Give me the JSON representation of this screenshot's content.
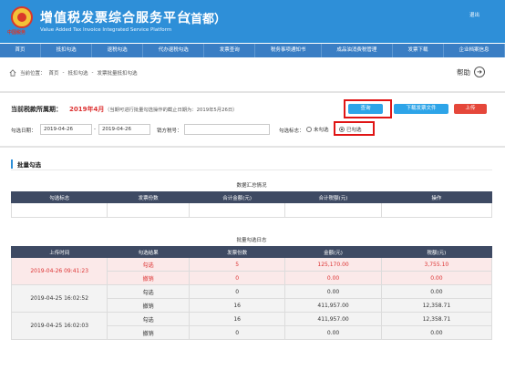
{
  "header": {
    "logo_text": "中国税务",
    "title": "增值税发票综合服务平台",
    "region": "（首都）",
    "subtitle": "Value Added Tax Invoice Integrated Service Platform",
    "logout": "退出"
  },
  "nav": {
    "items": [
      "首页",
      "抵扣勾选",
      "退税勾选",
      "代办退税勾选",
      "发票查询",
      "税务事项通知书",
      "成品油消费税管理",
      "发票下载",
      "企业档案信息"
    ]
  },
  "breadcrumb": {
    "prefix": "当前位置：",
    "path": [
      "首页",
      "抵扣勾选",
      "发票批量抵扣勾选"
    ],
    "separator": "-"
  },
  "help": {
    "label": "帮助",
    "icon": "arrow-right-circle-icon"
  },
  "period": {
    "label": "当前税款所属期：",
    "value": "2019年4月",
    "note": "（当期可进行批量勾选操作的截止日期为：2019年5月26日）"
  },
  "buttons": {
    "query": "查询",
    "download": "下载发票文件",
    "upload": "上传"
  },
  "filters": {
    "date_label": "勾选日期：",
    "date_from": "2019-04-26",
    "date_sep": "-",
    "date_to": "2019-04-26",
    "taxid_label": "销方税号：",
    "taxid_value": "",
    "flag_label": "勾选标志：",
    "options": [
      "未勾选",
      "已勾选"
    ],
    "selected": "已勾选"
  },
  "section": {
    "title": "批量勾选"
  },
  "summary": {
    "caption": "数据汇总情况",
    "columns": [
      "勾选标志",
      "发票份数",
      "合计金额(元)",
      "合计税额(元)",
      "操作"
    ],
    "rows": []
  },
  "log": {
    "caption": "批量勾选日志",
    "columns": [
      "上传时间",
      "勾选结果",
      "发票份数",
      "金额(元)",
      "税额(元)"
    ],
    "groups": [
      {
        "time": "2019-04-26 09:41:23",
        "rows": [
          {
            "result": "勾选",
            "count": "5",
            "amount": "125,170.00",
            "tax": "3,755.10"
          },
          {
            "result": "撤销",
            "count": "0",
            "amount": "0.00",
            "tax": "0.00"
          }
        ]
      },
      {
        "time": "2019-04-25 16:02:52",
        "rows": [
          {
            "result": "勾选",
            "count": "0",
            "amount": "0.00",
            "tax": "0.00"
          },
          {
            "result": "撤销",
            "count": "16",
            "amount": "411,957.00",
            "tax": "12,358.71"
          }
        ]
      },
      {
        "time": "2019-04-25 16:02:03",
        "rows": [
          {
            "result": "勾选",
            "count": "16",
            "amount": "411,957.00",
            "tax": "12,358.71"
          },
          {
            "result": "撤销",
            "count": "0",
            "amount": "0.00",
            "tax": "0.00"
          }
        ]
      }
    ]
  },
  "colors": {
    "header_bg": "#2e8fd8",
    "nav_bg": "#3a7ec4",
    "table_header": "#3e4a63",
    "highlight_red": "#e01515",
    "text_red": "#dd3333",
    "button_blue": "#2da4e8",
    "button_red": "#e5473a"
  }
}
